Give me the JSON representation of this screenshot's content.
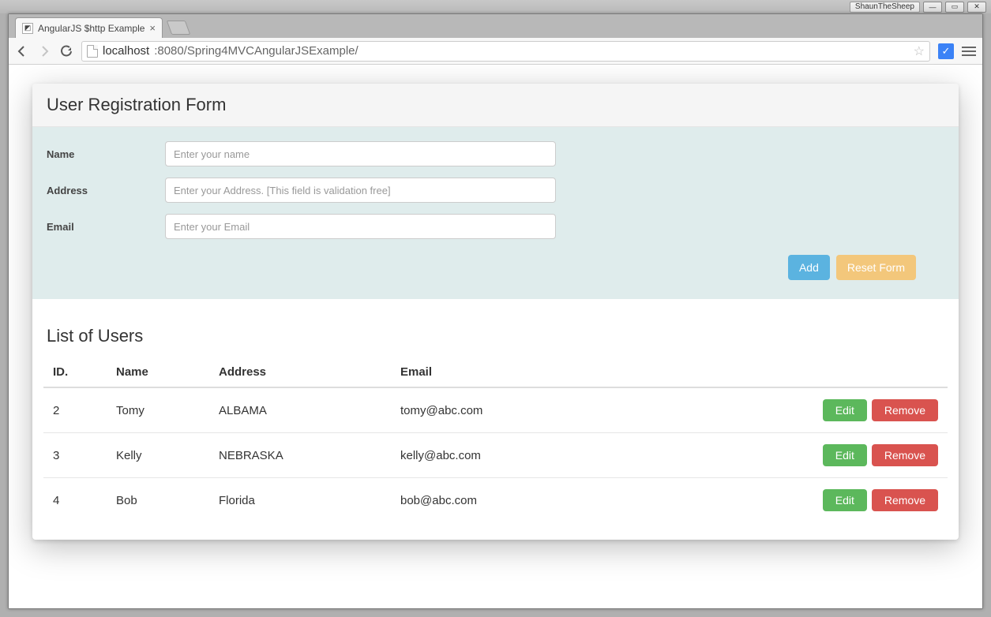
{
  "os": {
    "app_tag": "ShaunTheSheep",
    "minimize": "—",
    "maximize": "▭",
    "close": "✕"
  },
  "browser": {
    "tab_title": "AngularJS $http Example",
    "tab_close": "×",
    "url_host": "localhost",
    "url_path": ":8080/Spring4MVCAngularJSExample/"
  },
  "form": {
    "heading": "User Registration Form",
    "name_label": "Name",
    "name_placeholder": "Enter your name",
    "address_label": "Address",
    "address_placeholder": "Enter your Address. [This field is validation free]",
    "email_label": "Email",
    "email_placeholder": "Enter your Email",
    "add_button": "Add",
    "reset_button": "Reset Form"
  },
  "list": {
    "heading": "List of Users",
    "columns": {
      "id": "ID.",
      "name": "Name",
      "address": "Address",
      "email": "Email"
    },
    "edit_label": "Edit",
    "remove_label": "Remove",
    "rows": [
      {
        "id": "2",
        "name": "Tomy",
        "address": "ALBAMA",
        "email": "tomy@abc.com"
      },
      {
        "id": "3",
        "name": "Kelly",
        "address": "NEBRASKA",
        "email": "kelly@abc.com"
      },
      {
        "id": "4",
        "name": "Bob",
        "address": "Florida",
        "email": "bob@abc.com"
      }
    ]
  }
}
